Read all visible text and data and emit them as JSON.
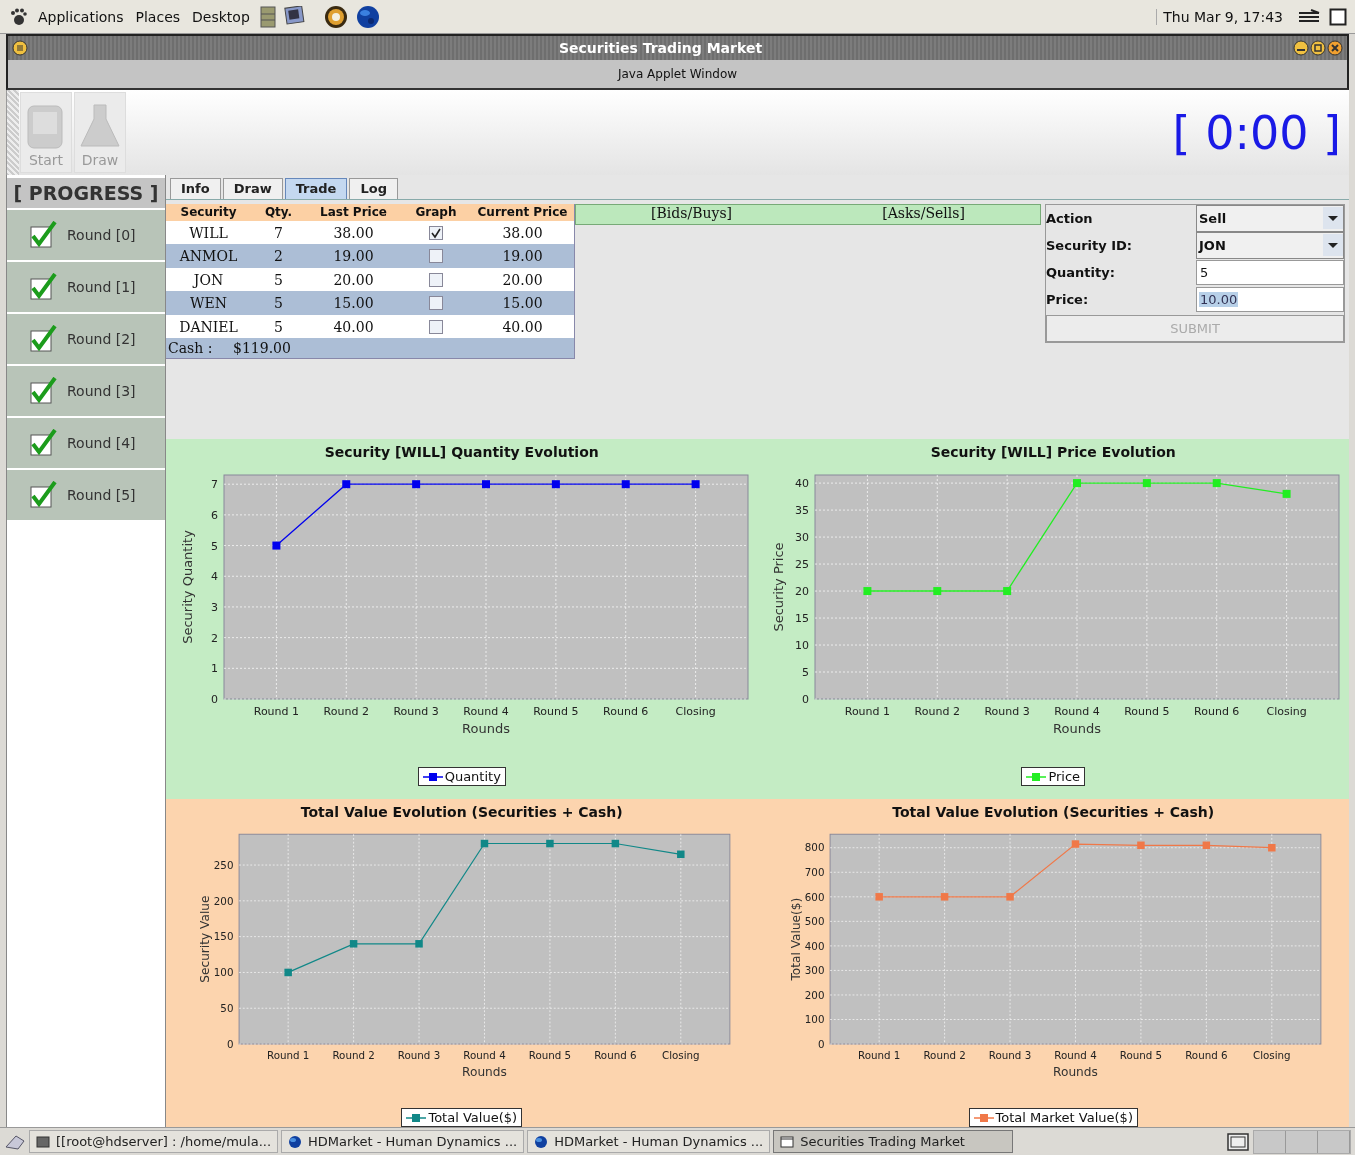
{
  "top_panel": {
    "menus": [
      "Applications",
      "Places",
      "Desktop"
    ],
    "clock": "Thu Mar  9, 17:43"
  },
  "window": {
    "title": "Securities Trading Market",
    "subtitle": "Java Applet Window"
  },
  "toolbar": {
    "buttons": [
      {
        "label": "Start",
        "kind": "start",
        "disabled": true
      },
      {
        "label": "Draw",
        "kind": "draw",
        "disabled": true
      }
    ],
    "timer": "[ 0:00 ]"
  },
  "sidebar": {
    "title": "[ PROGRESS ]",
    "items": [
      {
        "label": "Round [0]",
        "checked": true
      },
      {
        "label": "Round [1]",
        "checked": true
      },
      {
        "label": "Round [2]",
        "checked": true
      },
      {
        "label": "Round [3]",
        "checked": true
      },
      {
        "label": "Round [4]",
        "checked": true
      },
      {
        "label": "Round [5]",
        "checked": true
      }
    ]
  },
  "tabs": [
    {
      "label": "Info",
      "selected": false
    },
    {
      "label": "Draw",
      "selected": false
    },
    {
      "label": "Trade",
      "selected": true
    },
    {
      "label": "Log",
      "selected": false
    }
  ],
  "holdings": {
    "columns": [
      "Security",
      "Qty.",
      "Last Price",
      "Graph",
      "Current Price"
    ],
    "rows": [
      {
        "security": "WILL",
        "qty": "7",
        "last_price": "38.00",
        "graph": true,
        "current_price": "38.00"
      },
      {
        "security": "ANMOL",
        "qty": "2",
        "last_price": "19.00",
        "graph": false,
        "current_price": "19.00"
      },
      {
        "security": "JON",
        "qty": "5",
        "last_price": "20.00",
        "graph": false,
        "current_price": "20.00"
      },
      {
        "security": "WEN",
        "qty": "5",
        "last_price": "15.00",
        "graph": false,
        "current_price": "15.00"
      },
      {
        "security": "DANIEL",
        "qty": "5",
        "last_price": "40.00",
        "graph": false,
        "current_price": "40.00"
      }
    ],
    "cash_label": "Cash :",
    "cash": "$119.00"
  },
  "order_book": {
    "bids": "[Bids/Buys]",
    "asks": "[Asks/Sells]"
  },
  "order_form": {
    "fields": [
      {
        "label": "Action",
        "kind": "dropdown",
        "value": "Sell"
      },
      {
        "label": "Security ID:",
        "kind": "dropdown",
        "value": "JON"
      },
      {
        "label": "Quantity:",
        "kind": "text",
        "value": "5",
        "text_selected": false
      },
      {
        "label": "Price:",
        "kind": "text",
        "value": "10.00",
        "text_selected": true
      }
    ],
    "submit": {
      "label": "SUBMIT",
      "disabled": true
    }
  },
  "chart_panels": [
    {
      "color": "#c4ecc4",
      "charts": [
        {
          "chart_data": {
            "type": "line",
            "title": "Security [WILL] Quantity Evolution",
            "xlabel": "Rounds",
            "ylabel": "Security Quantity",
            "categories": [
              "Round 1",
              "Round 2",
              "Round 3",
              "Round 4",
              "Round 5",
              "Round 6",
              "Closing"
            ],
            "ylim": [
              0,
              7.3
            ],
            "yticks": [
              0,
              1,
              2,
              3,
              4,
              5,
              6,
              7
            ],
            "grid": true,
            "series": [
              {
                "name": "Quantity",
                "color": "#0000ee",
                "marker": "square",
                "values": [
                  5,
                  7,
                  7,
                  7,
                  7,
                  7,
                  7
                ]
              }
            ]
          }
        },
        {
          "chart_data": {
            "type": "line",
            "title": "Security [WILL] Price Evolution",
            "xlabel": "Rounds",
            "ylabel": "Security Price",
            "categories": [
              "Round 1",
              "Round 2",
              "Round 3",
              "Round 4",
              "Round 5",
              "Round 6",
              "Closing"
            ],
            "ylim": [
              0,
              41.5
            ],
            "yticks": [
              0,
              5,
              10,
              15,
              20,
              25,
              30,
              35,
              40
            ],
            "grid": true,
            "series": [
              {
                "name": "Price",
                "color": "#22ee22",
                "marker": "square",
                "values": [
                  20,
                  20,
                  20,
                  40,
                  40,
                  40,
                  38
                ]
              }
            ]
          }
        }
      ]
    },
    {
      "color": "#fcd4ae",
      "charts": [
        {
          "chart_data": {
            "type": "line",
            "title": "Total Value Evolution (Securities + Cash)",
            "xlabel": "Rounds",
            "ylabel": "Security Value",
            "categories": [
              "Round 1",
              "Round 2",
              "Round 3",
              "Round 4",
              "Round 5",
              "Round 6",
              "Closing"
            ],
            "ylim": [
              0,
              293
            ],
            "yticks": [
              0,
              50,
              100,
              150,
              200,
              250
            ],
            "grid": true,
            "series": [
              {
                "name": "Total Value($)",
                "color": "#118888",
                "marker": "square",
                "values": [
                  100,
                  140,
                  140,
                  280,
                  280,
                  280,
                  265
                ]
              }
            ]
          }
        },
        {
          "chart_data": {
            "type": "line",
            "title": "Total Value Evolution (Securities + Cash)",
            "xlabel": "Rounds",
            "ylabel": "Total Value($)",
            "categories": [
              "Round 1",
              "Round 2",
              "Round 3",
              "Round 4",
              "Round 5",
              "Round 6",
              "Closing"
            ],
            "ylim": [
              0,
              855
            ],
            "yticks": [
              0,
              100,
              200,
              300,
              400,
              500,
              600,
              700,
              800
            ],
            "grid": true,
            "series": [
              {
                "name": "Total Market Value($)",
                "color": "#f07848",
                "marker": "square",
                "values": [
                  600,
                  600,
                  600,
                  815,
                  810,
                  810,
                  800
                ]
              }
            ]
          }
        }
      ]
    }
  ],
  "taskbar": {
    "items": [
      {
        "label": "[[root@hdserver] : /home/mula...",
        "kind": "terminal",
        "selected": false
      },
      {
        "label": "HDMarket - Human Dynamics ...",
        "kind": "browser",
        "selected": false
      },
      {
        "label": "HDMarket - Human Dynamics ...",
        "kind": "browser",
        "selected": false
      },
      {
        "label": "Securities Trading Market",
        "kind": "window",
        "selected": true
      }
    ]
  }
}
